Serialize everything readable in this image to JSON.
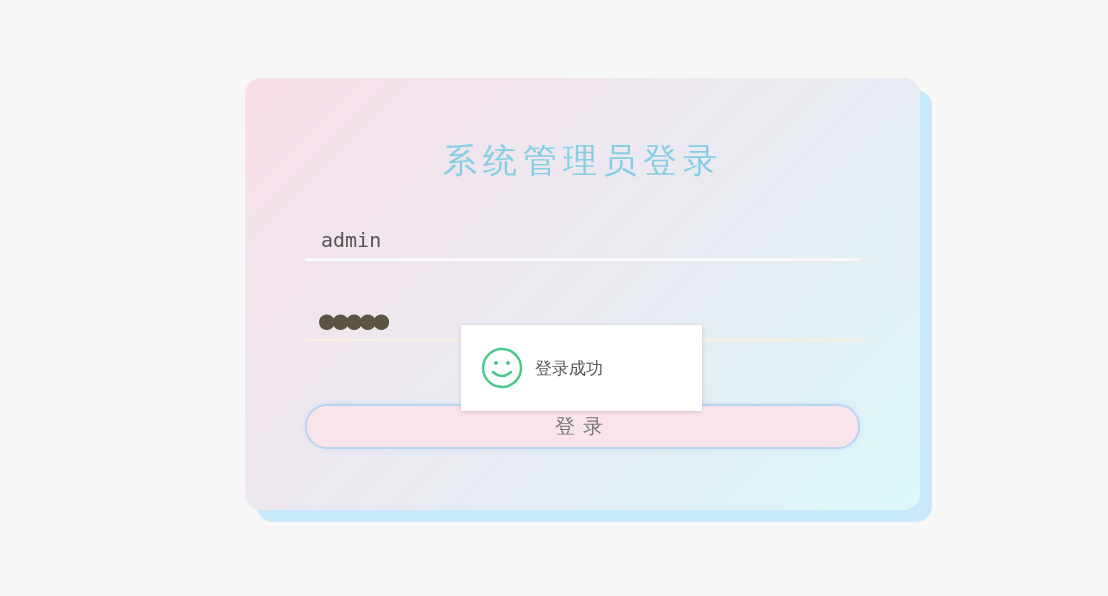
{
  "login_card": {
    "title": "系统管理员登录",
    "username": {
      "value": "admin"
    },
    "password": {
      "value": "●●●●●"
    },
    "login_button": "登录"
  },
  "toast": {
    "message": "登录成功"
  }
}
